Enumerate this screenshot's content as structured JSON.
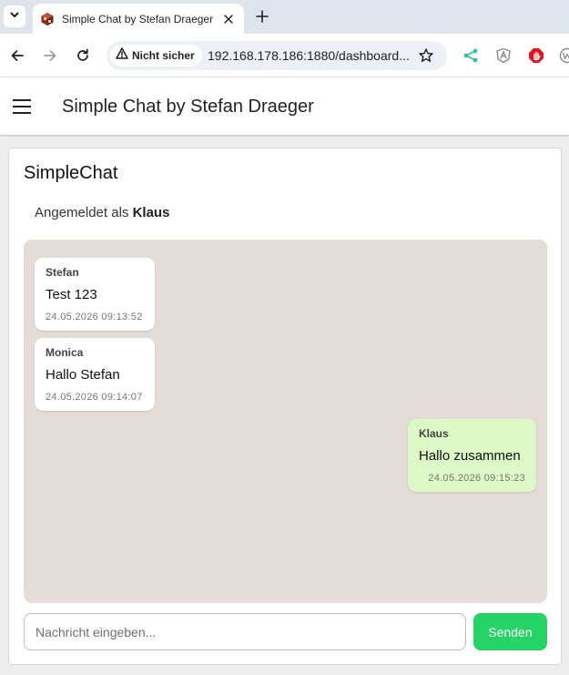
{
  "browser": {
    "tab_title": "Simple Chat by Stefan Draeger",
    "security_label": "Nicht sicher",
    "url": "192.168.178.186:1880/dashboard..."
  },
  "app": {
    "title": "Simple Chat by Stefan Draeger"
  },
  "chat": {
    "card_title": "SimpleChat",
    "logged_in_prefix": "Angemeldet als",
    "logged_in_user": "Klaus",
    "messages": [
      {
        "sender": "Stefan",
        "text": "Test 123",
        "time": "24.05.2026 09:13:52",
        "direction": "incoming"
      },
      {
        "sender": "Monica",
        "text": "Hallo Stefan",
        "time": "24.05.2026 09:14:07",
        "direction": "incoming"
      },
      {
        "sender": "Klaus",
        "text": "Hallo zusammen",
        "time": "24.05.2026 09:15:23",
        "direction": "outgoing"
      }
    ],
    "input_placeholder": "Nachricht eingeben...",
    "input_value": "",
    "send_label": "Senden"
  },
  "colors": {
    "chat_background": "#e4dcd6",
    "incoming_bubble": "#ffffff",
    "outgoing_bubble": "#dcf8c6",
    "send_button": "#25d366",
    "share_icon": "#2ec4a0",
    "adblock_icon": "#e0141e"
  }
}
